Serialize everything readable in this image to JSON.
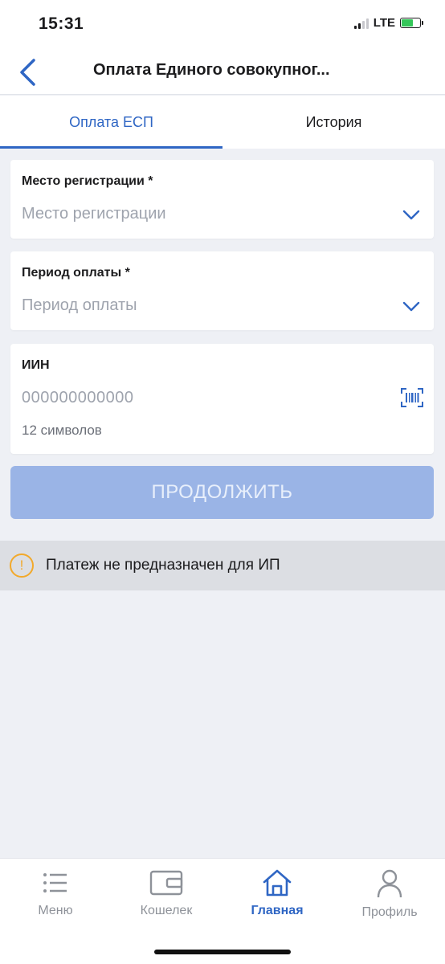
{
  "status": {
    "time": "15:31",
    "network": "LTE"
  },
  "header": {
    "title": "Оплата Единого совокупног...",
    "back_icon": "chevron-left-icon"
  },
  "tabs": [
    {
      "label": "Оплата ЕСП",
      "active": true
    },
    {
      "label": "История",
      "active": false
    }
  ],
  "form": {
    "registration": {
      "label": "Место регистрации *",
      "placeholder": "Место регистрации"
    },
    "period": {
      "label": "Период оплаты *",
      "placeholder": "Период оплаты"
    },
    "iin": {
      "label": "ИИН",
      "placeholder": "000000000000",
      "hint": "12 символов"
    }
  },
  "continue_label": "ПРОДОЛЖИТЬ",
  "notice": {
    "icon_text": "!",
    "text": "Платеж не предназначен для ИП"
  },
  "bottom_nav": [
    {
      "label": "Меню",
      "icon": "menu-list-icon",
      "active": false
    },
    {
      "label": "Кошелек",
      "icon": "wallet-icon",
      "active": false
    },
    {
      "label": "Главная",
      "icon": "home-icon",
      "active": true
    },
    {
      "label": "Профиль",
      "icon": "profile-icon",
      "active": false
    }
  ],
  "colors": {
    "accent": "#2f66c4",
    "button_disabled": "#9ab4e6",
    "warning": "#f2a92b",
    "background": "#eef0f5"
  }
}
